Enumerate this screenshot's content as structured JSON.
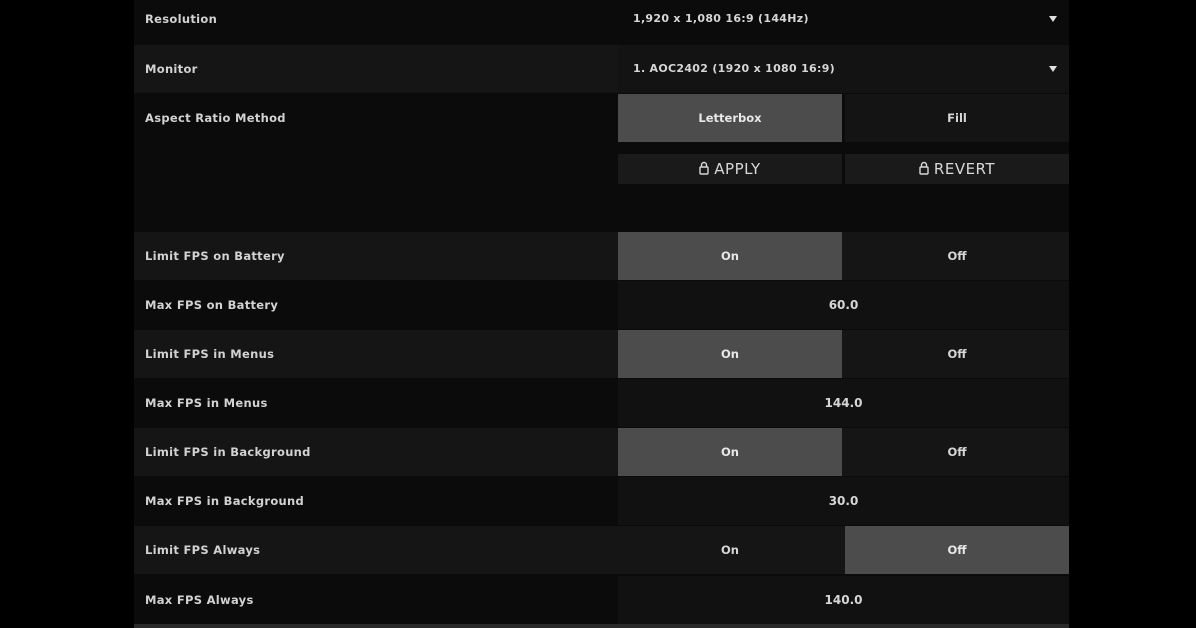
{
  "display": {
    "resolution": {
      "label": "Resolution",
      "value": "1,920 x 1,080 16:9 (144Hz)"
    },
    "monitor": {
      "label": "Monitor",
      "value": "1. AOC2402 (1920 x  1080 16:9)"
    },
    "aspect_ratio_method": {
      "label": "Aspect Ratio Method",
      "options": [
        "Letterbox",
        "Fill"
      ],
      "selected": "Letterbox"
    },
    "apply_label": "APPLY",
    "revert_label": "REVERT"
  },
  "fps": [
    {
      "label": "Limit FPS on Battery",
      "type": "toggle",
      "options": [
        "On",
        "Off"
      ],
      "selected": "On"
    },
    {
      "label": "Max FPS on Battery",
      "type": "number",
      "value": "60.0"
    },
    {
      "label": "Limit FPS in Menus",
      "type": "toggle",
      "options": [
        "On",
        "Off"
      ],
      "selected": "On"
    },
    {
      "label": "Max FPS in Menus",
      "type": "number",
      "value": "144.0"
    },
    {
      "label": "Limit FPS in Background",
      "type": "toggle",
      "options": [
        "On",
        "Off"
      ],
      "selected": "On"
    },
    {
      "label": "Max FPS in Background",
      "type": "number",
      "value": "30.0"
    },
    {
      "label": "Limit FPS Always",
      "type": "toggle",
      "options": [
        "On",
        "Off"
      ],
      "selected": "Off"
    },
    {
      "label": "Max FPS Always",
      "type": "number",
      "value": "140.0"
    }
  ],
  "colors": {
    "background": "#000000",
    "panel": "#0b0b0b",
    "selected": "#4c4c4c",
    "text": "#d6d6d6"
  },
  "icons": {
    "action_button_icon": "lock-icon",
    "dropdown_icon": "caret-down-icon"
  }
}
